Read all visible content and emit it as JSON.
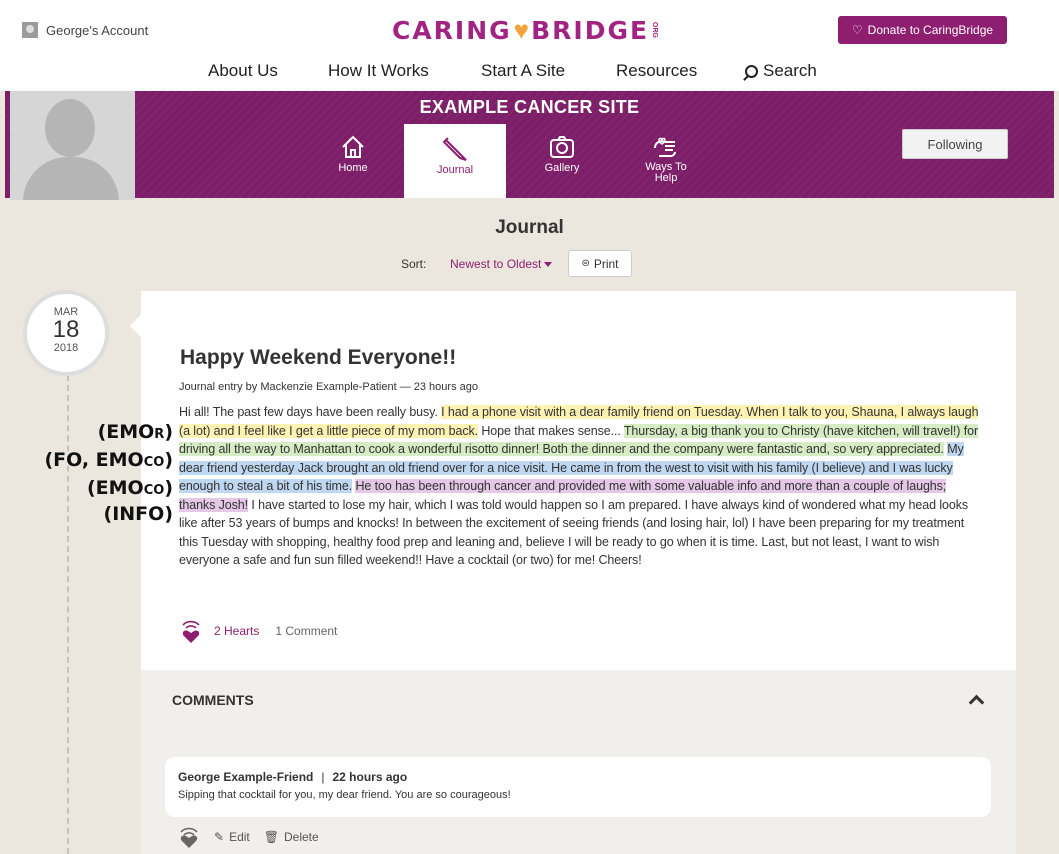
{
  "header": {
    "account_label": "George's Account",
    "logo": {
      "left": "CARING",
      "right": "BRIDGE",
      "suffix": "ORG"
    },
    "donate_label": "Donate to CaringBridge",
    "nav": [
      "About Us",
      "How It Works",
      "Start A Site",
      "Resources",
      "Search"
    ]
  },
  "site": {
    "title": "EXAMPLE CANCER SITE",
    "tabs": [
      {
        "label": "Home",
        "icon": "home-icon"
      },
      {
        "label": "Journal",
        "icon": "pencil-icon",
        "active": true
      },
      {
        "label": "Gallery",
        "icon": "camera-icon"
      },
      {
        "label_line1": "Ways To",
        "label_line2": "Help",
        "icon": "helping-hand-icon"
      }
    ],
    "following_label": "Following"
  },
  "journal": {
    "heading": "Journal",
    "sort_label": "Sort:",
    "sort_value": "Newest to Oldest",
    "print_label": "Print"
  },
  "entry": {
    "date": {
      "month": "MAR",
      "day": "18",
      "year": "2018"
    },
    "title": "Happy Weekend Everyone!!",
    "meta": "Journal entry by Mackenzie Example-Patient — 23 hours ago",
    "body": {
      "s1": "Hi all! The past few days have been really busy. ",
      "s2": "I had a phone visit with a dear family friend on Tuesday. When I talk to you, Shauna, I always laugh (a lot) and I feel like I get a little piece of my mom back.",
      "s3": " Hope that makes sense... ",
      "s4": "Thursday, a big thank you to Christy (have kitchen, will travel!) for driving all the way to Manhattan to cook a wonderful risotto dinner! Both the dinner and the company were fantastic and, so very appreciated.",
      "s5": " ",
      "s6": "My dear friend yesterday Jack brought an old friend over for a nice visit. He came in from the west to visit with his family (I believe) and I was lucky enough to steal a bit of his time.",
      "s7": " ",
      "s8": "He too has been through cancer and provided me with some valuable info and more than a couple of laughs; thanks Josh!",
      "s9": " I have started to lose my hair, which I was told would happen so I am prepared. I have always kind of wondered what my head looks like after 53 years of bumps and knocks! In between the excitement of seeing friends (and losing hair, lol) I have been preparing for my treatment this Tuesday with shopping, healthy food prep and leaning and, believe I will be ready to go when it is time. Last, but not least, I want to wish everyone a safe and fun sun filled weekend!! Have a cocktail (or two) for me! Cheers!"
    },
    "hearts_label": "2 Hearts",
    "comments_count_label": "1 Comment"
  },
  "annotations": {
    "a1_main": "(EMO",
    "a1_small": "R",
    "a1_end": ")",
    "a2_main": "(FO, EMO",
    "a2_small": "CO",
    "a2_end": ")",
    "a3_main": "(EMO",
    "a3_small": "CO",
    "a3_end": ")",
    "a4": "(INFO)"
  },
  "comments": {
    "title": "COMMENTS",
    "items": [
      {
        "author": "George Example-Friend",
        "time": "22 hours ago",
        "text": "Sipping that cocktail for you, my dear friend. You are so courageous!"
      }
    ],
    "edit_label": "Edit",
    "delete_label": "Delete"
  },
  "colors": {
    "brand_purple": "#7d1e68",
    "accent_purple": "#8e1f70",
    "highlight_yellow": "#fff3b3",
    "highlight_green": "#d6ecc4",
    "highlight_blue": "#bfd7f0",
    "highlight_purple": "#e4c8e5"
  }
}
